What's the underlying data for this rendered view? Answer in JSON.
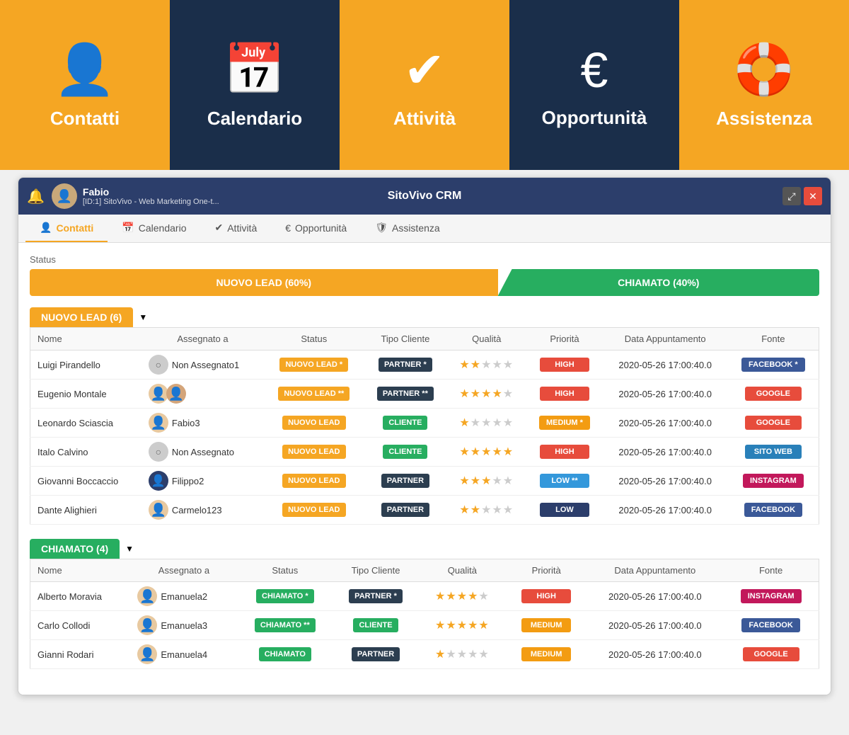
{
  "banner": {
    "items": [
      {
        "id": "contatti",
        "label": "Contatti",
        "icon": "👤",
        "theme": "orange"
      },
      {
        "id": "calendario",
        "label": "Calendario",
        "icon": "📅",
        "theme": "dark-blue"
      },
      {
        "id": "attivita",
        "label": "Attività",
        "icon": "✔",
        "theme": "orange"
      },
      {
        "id": "opportunita",
        "label": "Opportunità",
        "icon": "€",
        "theme": "dark-blue"
      },
      {
        "id": "assistenza",
        "label": "Assistenza",
        "icon": "🛟",
        "theme": "orange"
      }
    ]
  },
  "crm": {
    "title": "SitoVivo CRM",
    "user": {
      "name": "Fabio",
      "subtitle": "[ID:1] SitoVivo - Web Marketing One-t..."
    },
    "nav": {
      "tabs": [
        {
          "id": "contatti",
          "label": "Contatti",
          "icon": "👤",
          "active": true
        },
        {
          "id": "calendario",
          "label": "Calendario",
          "icon": "📅",
          "active": false
        },
        {
          "id": "attivita",
          "label": "Attività",
          "icon": "✔",
          "active": false
        },
        {
          "id": "opportunita",
          "label": "Opportunità",
          "icon": "€",
          "active": false
        },
        {
          "id": "assistenza",
          "label": "Assistenza",
          "icon": "🛡",
          "active": false
        }
      ]
    },
    "status": {
      "label": "Status",
      "segments": [
        {
          "label": "NUOVO LEAD (60%)",
          "type": "orange"
        },
        {
          "label": "CHIAMATO (40%)",
          "type": "green"
        }
      ]
    },
    "nuovo_lead": {
      "title": "NUOVO LEAD (6)",
      "theme": "orange",
      "columns": [
        "Nome",
        "Assegnato a",
        "Status",
        "Tipo Cliente",
        "Qualità",
        "Priorità",
        "Data Appuntamento",
        "Fonte"
      ],
      "rows": [
        {
          "nome": "Luigi Pirandello",
          "assegnato": "Non Assegnato1",
          "assegnato_type": "empty",
          "status": "NUOVO LEAD *",
          "status_type": "orange",
          "tipo": "PARTNER *",
          "tipo_type": "dark",
          "stars": 2,
          "priorita": "HIGH",
          "priorita_type": "high",
          "data": "2020-05-26 17:00:40.0",
          "fonte": "FACEBOOK *",
          "fonte_type": "facebook"
        },
        {
          "nome": "Eugenio Montale",
          "assegnato": "",
          "assegnato_type": "pair",
          "status": "NUOVO LEAD **",
          "status_type": "orange",
          "tipo": "PARTNER **",
          "tipo_type": "dark",
          "stars": 4,
          "priorita": "HIGH",
          "priorita_type": "high",
          "data": "2020-05-26 17:00:40.0",
          "fonte": "GOOGLE",
          "fonte_type": "google"
        },
        {
          "nome": "Leonardo Sciascia",
          "assegnato": "Fabio3",
          "assegnato_type": "person",
          "status": "NUOVO LEAD",
          "status_type": "orange",
          "tipo": "CLIENTE",
          "tipo_type": "green",
          "stars": 1,
          "priorita": "MEDIUM *",
          "priorita_type": "medium",
          "data": "2020-05-26 17:00:40.0",
          "fonte": "GOOGLE",
          "fonte_type": "google"
        },
        {
          "nome": "Italo Calvino",
          "assegnato": "Non Assegnato",
          "assegnato_type": "empty",
          "status": "NUOVO LEAD",
          "status_type": "orange",
          "tipo": "CLIENTE",
          "tipo_type": "green",
          "stars": 5,
          "priorita": "HIGH",
          "priorita_type": "high",
          "data": "2020-05-26 17:00:40.0",
          "fonte": "SITO WEB",
          "fonte_type": "sitoweb"
        },
        {
          "nome": "Giovanni Boccaccio",
          "assegnato": "Filippo2",
          "assegnato_type": "dark",
          "status": "NUOVO LEAD",
          "status_type": "orange",
          "tipo": "PARTNER",
          "tipo_type": "dark",
          "stars": 3,
          "priorita": "LOW **",
          "priorita_type": "low",
          "data": "2020-05-26 17:00:40.0",
          "fonte": "INSTAGRAM",
          "fonte_type": "instagram"
        },
        {
          "nome": "Dante Alighieri",
          "assegnato": "Carmelo123",
          "assegnato_type": "person2",
          "status": "NUOVO LEAD",
          "status_type": "orange",
          "tipo": "PARTNER",
          "tipo_type": "dark",
          "stars": 2,
          "priorita": "LOW",
          "priorita_type": "low-dark",
          "data": "2020-05-26 17:00:40.0",
          "fonte": "FACEBOOK",
          "fonte_type": "facebook"
        }
      ]
    },
    "chiamato": {
      "title": "CHIAMATO (4)",
      "theme": "green",
      "columns": [
        "Nome",
        "Assegnato a",
        "Status",
        "Tipo Cliente",
        "Qualità",
        "Priorità",
        "Data Appuntamento",
        "Fonte"
      ],
      "rows": [
        {
          "nome": "Alberto Moravia",
          "assegnato": "Emanuela2",
          "assegnato_type": "person",
          "status": "CHIAMATO *",
          "status_type": "green",
          "tipo": "PARTNER *",
          "tipo_type": "dark",
          "stars": 4,
          "priorita": "HIGH",
          "priorita_type": "high",
          "data": "2020-05-26 17:00:40.0",
          "fonte": "INSTAGRAM",
          "fonte_type": "instagram"
        },
        {
          "nome": "Carlo Collodi",
          "assegnato": "Emanuela3",
          "assegnato_type": "person",
          "status": "CHIAMATO **",
          "status_type": "green",
          "tipo": "CLIENTE",
          "tipo_type": "green",
          "stars": 5,
          "priorita": "MEDIUM",
          "priorita_type": "medium",
          "data": "2020-05-26 17:00:40.0",
          "fonte": "FACEBOOK",
          "fonte_type": "facebook"
        },
        {
          "nome": "Gianni Rodari",
          "assegnato": "Emanuela4",
          "assegnato_type": "person",
          "status": "CHIAMATO",
          "status_type": "green",
          "tipo": "PARTNER",
          "tipo_type": "dark",
          "stars": 1,
          "priorita": "MEDIUM",
          "priorita_type": "medium",
          "data": "2020-05-26 17:00:40.0",
          "fonte": "GOOGLE",
          "fonte_type": "google"
        }
      ]
    }
  }
}
